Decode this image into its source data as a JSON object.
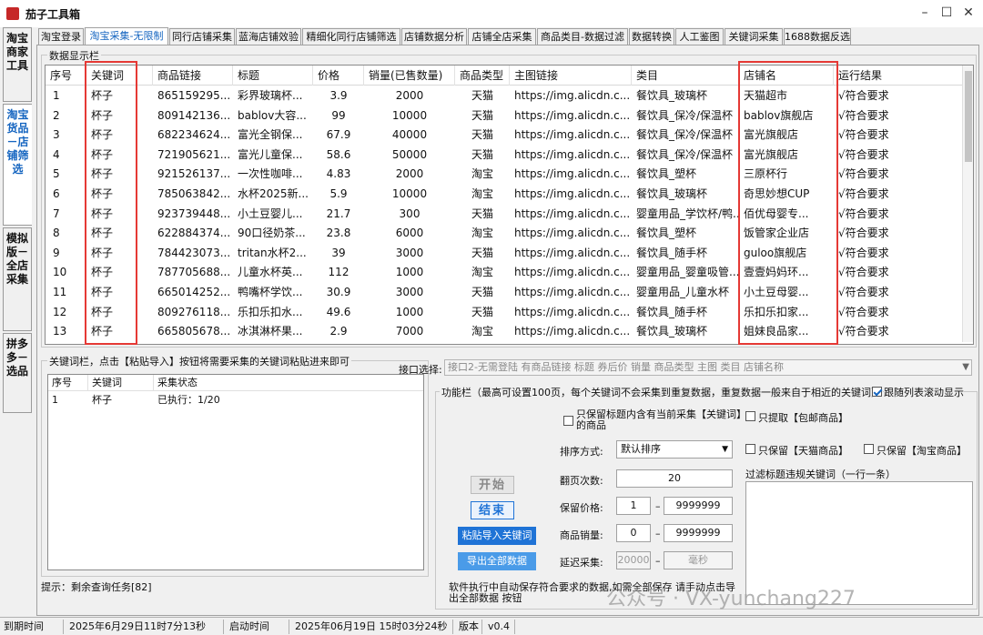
{
  "app": {
    "title": "茄子工具箱"
  },
  "window_controls": {
    "minimize": "–",
    "maximize": "☐",
    "close": "✕"
  },
  "side_tabs": [
    "淘宝商家工具",
    "淘宝货品－店铺筛选",
    "模拟版－全店采集",
    "拼多多－选品"
  ],
  "top_tabs": [
    "淘宝登录",
    "淘宝采集-无限制",
    "同行店铺采集",
    "蓝海店铺效验",
    "精细化同行店铺筛选",
    "店铺数据分析",
    "店铺全店采集",
    "商品类目-数据过滤",
    "数据转换",
    "人工鉴图",
    "关键词采集",
    "1688数据反选"
  ],
  "data_panel": {
    "title": "数据显示栏",
    "headers": [
      "序号",
      "关键词",
      "商品链接",
      "标题",
      "价格",
      "销量(已售数量)",
      "商品类型",
      "主图链接",
      "类目",
      "店铺名",
      "运行结果"
    ],
    "rows": [
      [
        "1",
        "杯子",
        "865159295...",
        "彩界玻璃杯...",
        "3.9",
        "2000",
        "天猫",
        "https://img.alicdn.c...",
        "餐饮具_玻璃杯",
        "天猫超市",
        "√符合要求"
      ],
      [
        "2",
        "杯子",
        "809142136...",
        "bablov大容...",
        "99",
        "10000",
        "天猫",
        "https://img.alicdn.c...",
        "餐饮具_保冷/保温杯",
        "bablov旗舰店",
        "√符合要求"
      ],
      [
        "3",
        "杯子",
        "682234624...",
        "富光全钢保...",
        "67.9",
        "40000",
        "天猫",
        "https://img.alicdn.c...",
        "餐饮具_保冷/保温杯",
        "富光旗舰店",
        "√符合要求"
      ],
      [
        "4",
        "杯子",
        "721905621...",
        "富光儿童保...",
        "58.6",
        "50000",
        "天猫",
        "https://img.alicdn.c...",
        "餐饮具_保冷/保温杯",
        "富光旗舰店",
        "√符合要求"
      ],
      [
        "5",
        "杯子",
        "921526137...",
        "一次性咖啡...",
        "4.83",
        "2000",
        "淘宝",
        "https://img.alicdn.c...",
        "餐饮具_塑杯",
        "三原杯行",
        "√符合要求"
      ],
      [
        "6",
        "杯子",
        "785063842...",
        "水杯2025新...",
        "5.9",
        "10000",
        "淘宝",
        "https://img.alicdn.c...",
        "餐饮具_玻璃杯",
        "奇思妙想CUP",
        "√符合要求"
      ],
      [
        "7",
        "杯子",
        "923739448...",
        "小土豆婴儿...",
        "21.7",
        "300",
        "天猫",
        "https://img.alicdn.c...",
        "婴童用品_学饮杯/鸭...",
        "佰优母婴专...",
        "√符合要求"
      ],
      [
        "8",
        "杯子",
        "622884374...",
        "90口径奶茶...",
        "23.8",
        "6000",
        "淘宝",
        "https://img.alicdn.c...",
        "餐饮具_塑杯",
        "饭管家企业店",
        "√符合要求"
      ],
      [
        "9",
        "杯子",
        "784423073...",
        "tritan水杯2...",
        "39",
        "3000",
        "天猫",
        "https://img.alicdn.c...",
        "餐饮具_随手杯",
        "guloo旗舰店",
        "√符合要求"
      ],
      [
        "10",
        "杯子",
        "787705688...",
        "儿童水杯英...",
        "112",
        "1000",
        "淘宝",
        "https://img.alicdn.c...",
        "婴童用品_婴童吸管...",
        "壹壹妈妈环...",
        "√符合要求"
      ],
      [
        "11",
        "杯子",
        "665014252...",
        "鸭嘴杯学饮...",
        "30.9",
        "3000",
        "天猫",
        "https://img.alicdn.c...",
        "婴童用品_儿童水杯",
        "小土豆母婴...",
        "√符合要求"
      ],
      [
        "12",
        "杯子",
        "809276118...",
        "乐扣乐扣水...",
        "49.6",
        "1000",
        "天猫",
        "https://img.alicdn.c...",
        "餐饮具_随手杯",
        "乐扣乐扣家...",
        "√符合要求"
      ],
      [
        "13",
        "杯子",
        "665805678...",
        "冰淇淋杯果...",
        "2.9",
        "7000",
        "淘宝",
        "https://img.alicdn.c...",
        "餐饮具_玻璃杯",
        "姐妹良品家...",
        "√符合要求"
      ]
    ]
  },
  "keyword_panel": {
    "title": "关键词栏，点击【粘贴导入】按钮将需要采集的关键词粘贴进来即可",
    "headers": [
      "序号",
      "关键词",
      "采集状态"
    ],
    "rows": [
      [
        "1",
        "杯子",
        "已执行：1/20"
      ]
    ],
    "hint": "提示：剩余查询任务[82]"
  },
  "interface": {
    "label": "接口选择:",
    "value": "接口2-无需登陆 有商品链接 标题 券后价 销量 商品类型 主图 类目 店铺名称"
  },
  "function_panel": {
    "title": "功能栏（最高可设置100页，每个关键词不会采集到重复数据，重复数据一般来自于相近的关键词）",
    "follow_scroll": {
      "label": "跟随列表滚动显示",
      "checked": true
    },
    "start_label": "开始",
    "end_label": "结束",
    "keep_title_kw": "只保留标题内含有当前采集【关键词】的商品",
    "only_free_shipping": "只提取【包邮商品】",
    "keep_tmall": "只保留【天猫商品】",
    "keep_taobao": "只保留【淘宝商品】",
    "sort_label": "排序方式:",
    "sort_value": "默认排序",
    "pages_label": "翻页次数:",
    "pages_value": "20",
    "price_label": "保留价格:",
    "price_min": "1",
    "price_max": "9999999",
    "sales_label": "商品销量:",
    "sales_min": "0",
    "sales_max": "9999999",
    "delay_label": "延迟采集:",
    "delay_value": "20000",
    "delay_unit": "毫秒",
    "dash": "–",
    "filter_label": "过滤标题违规关键词（一行一条）",
    "paste_button": "粘贴导入关键词",
    "export_button": "导出全部数据",
    "save_note": "软件执行中自动保存符合要求的数据,如需全部保存 请手动点击导出全部数据 按钮"
  },
  "watermark": "公众号 · VX-yunchang227",
  "statusbar": [
    "到期时间",
    "2025年6月29日11时7分13秒",
    "启动时间",
    "2025年06月19日 15时03分24秒",
    "版本",
    "v0.4"
  ],
  "colors": {
    "accent": "#1565c0",
    "highlight_border": "#e53935",
    "button_blue": "#1f73d6"
  }
}
